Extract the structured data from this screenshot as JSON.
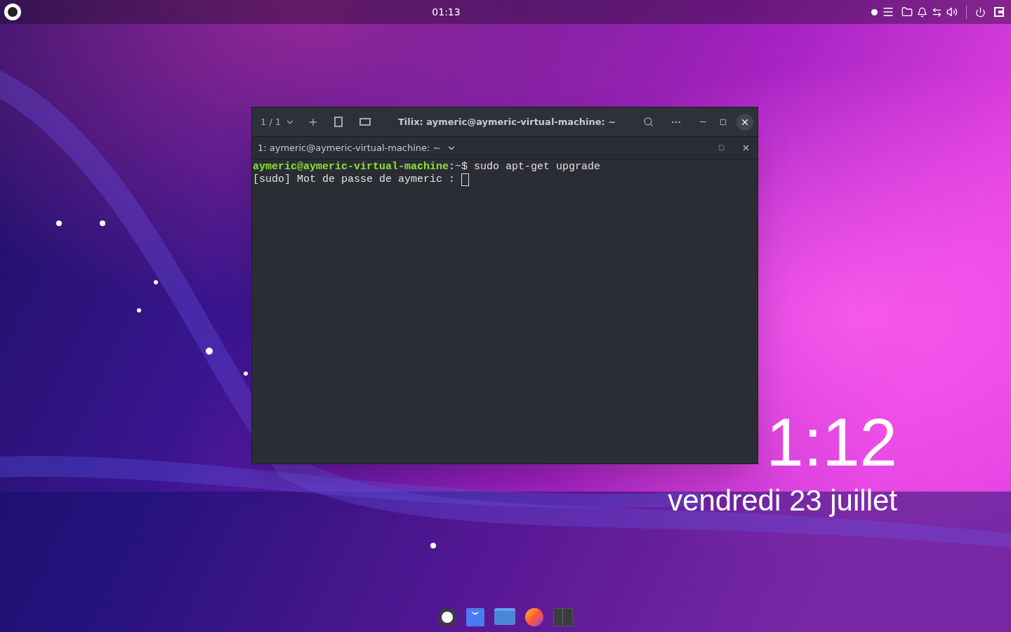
{
  "top_bar": {
    "clock": "01:13"
  },
  "desktop_clock": {
    "time": "1:12",
    "date": "vendredi 23 juillet"
  },
  "terminal": {
    "tab_counter": "1 / 1",
    "title": "Tilix: aymeric@aymeric-virtual-machine: ~",
    "session_title": "1: aymeric@aymeric-virtual-machine: ~",
    "lines": [
      {
        "kind": "prompt",
        "user": "aymeric@aymeric-virtual-machine",
        "separator": ":",
        "path": "~",
        "symbol": "$",
        "command": " sudo apt-get upgrade"
      },
      {
        "kind": "output",
        "text": "[sudo] Mot de passe de aymeric : ",
        "cursor": true
      }
    ]
  }
}
